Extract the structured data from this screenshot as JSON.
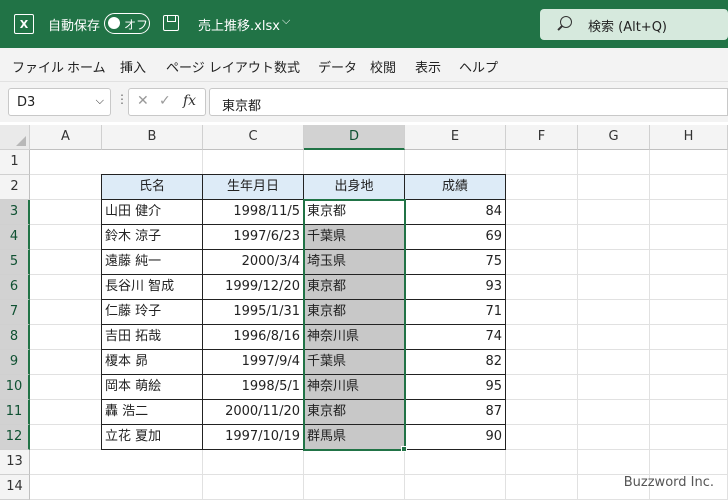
{
  "titlebar": {
    "app_icon": "X",
    "autosave_label": "自動保存",
    "autosave_state": "オフ",
    "filename": "売上推移.xlsx",
    "search_text": "検索 (Alt+Q)"
  },
  "menu": [
    "ファイル",
    "ホーム",
    "挿入",
    "ページ レイアウト",
    "数式",
    "データ",
    "校閲",
    "表示",
    "ヘルプ"
  ],
  "formula_bar": {
    "name_box": "D3",
    "fx": "fx",
    "content": "東京都"
  },
  "columns": [
    "A",
    "B",
    "C",
    "D",
    "E",
    "F",
    "G",
    "H"
  ],
  "rows": [
    "1",
    "2",
    "3",
    "4",
    "5",
    "6",
    "7",
    "8",
    "9",
    "10",
    "11",
    "12",
    "13",
    "14"
  ],
  "table": {
    "headers": [
      "氏名",
      "生年月日",
      "出身地",
      "成績"
    ],
    "rows": [
      [
        "山田 健介",
        "1998/11/5",
        "東京都",
        "84"
      ],
      [
        "鈴木 涼子",
        "1997/6/23",
        "千葉県",
        "69"
      ],
      [
        "遠藤 純一",
        "2000/3/4",
        "埼玉県",
        "75"
      ],
      [
        "長谷川 智成",
        "1999/12/20",
        "東京都",
        "93"
      ],
      [
        "仁藤 玲子",
        "1995/1/31",
        "東京都",
        "71"
      ],
      [
        "吉田 拓哉",
        "1996/8/16",
        "神奈川県",
        "74"
      ],
      [
        "榎本 昴",
        "1997/9/4",
        "千葉県",
        "82"
      ],
      [
        "岡本 萌絵",
        "1998/5/1",
        "神奈川県",
        "95"
      ],
      [
        "轟 浩二",
        "2000/11/20",
        "東京都",
        "87"
      ],
      [
        "立花 夏加",
        "1997/10/19",
        "群馬県",
        "90"
      ]
    ]
  },
  "watermark": "Buzzword Inc."
}
